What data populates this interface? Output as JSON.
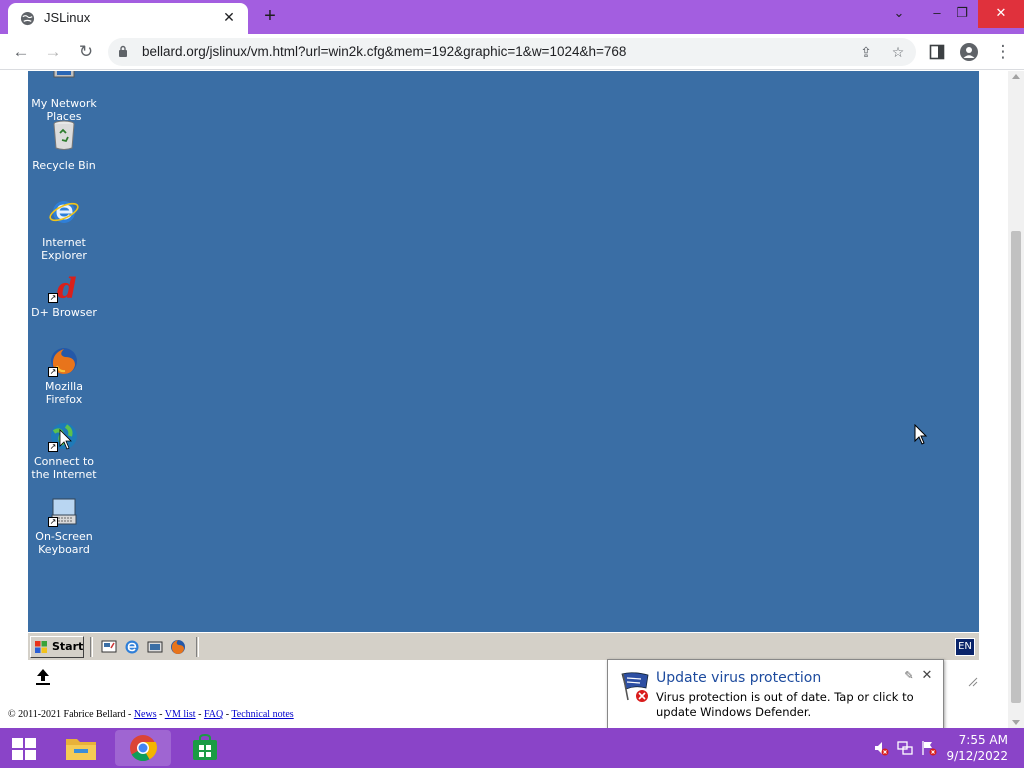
{
  "browser": {
    "tab_title": "JSLinux",
    "url": "bellard.org/jslinux/vm.html?url=win2k.cfg&mem=192&graphic=1&w=1024&h=768",
    "accent_color": "#a35ee0"
  },
  "desktop": {
    "background_color": "#3a6ea5",
    "icons": [
      {
        "label": "My Network\nPlaces",
        "icon": "network-places-icon"
      },
      {
        "label": "Recycle Bin",
        "icon": "recycle-bin-icon"
      },
      {
        "label": "Internet\nExplorer",
        "icon": "internet-explorer-icon"
      },
      {
        "label": "D+ Browser",
        "icon": "dplus-browser-icon"
      },
      {
        "label": "Mozilla Firefox",
        "icon": "firefox-icon"
      },
      {
        "label": "Connect to\nthe Internet",
        "icon": "connect-internet-icon"
      },
      {
        "label": "On-Screen\nKeyboard",
        "icon": "onscreen-keyboard-icon"
      }
    ]
  },
  "vm_taskbar": {
    "start_label": "Start",
    "language": "EN"
  },
  "footer": {
    "copyright": "© 2011-2021 Fabrice Bellard - ",
    "sep": " - ",
    "links": [
      "News",
      "VM list",
      "FAQ",
      "Technical notes"
    ]
  },
  "notification": {
    "title": "Update virus protection",
    "body": "Virus protection is out of date. Tap or click to update Windows Defender."
  },
  "system_taskbar": {
    "time": "7:55 AM",
    "date": "9/12/2022"
  }
}
